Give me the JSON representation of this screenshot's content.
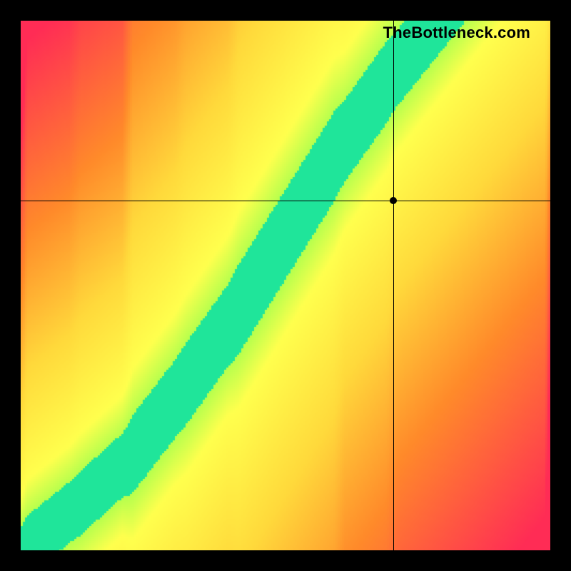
{
  "watermark": "TheBottleneck.com",
  "chart_data": {
    "type": "heatmap",
    "title": "",
    "xlabel": "",
    "ylabel": "",
    "xlim": [
      0,
      1
    ],
    "ylim": [
      0,
      1
    ],
    "crosshair": {
      "x": 0.705,
      "y": 0.66
    },
    "marker": {
      "x": 0.705,
      "y": 0.66
    },
    "optimal_band": {
      "description": "Green diagonal band of optimal balance; outside band transitions through yellow to orange to red.",
      "center_points": [
        {
          "x": 0.0,
          "y": 0.0
        },
        {
          "x": 0.1,
          "y": 0.08
        },
        {
          "x": 0.2,
          "y": 0.17
        },
        {
          "x": 0.3,
          "y": 0.3
        },
        {
          "x": 0.4,
          "y": 0.44
        },
        {
          "x": 0.5,
          "y": 0.6
        },
        {
          "x": 0.6,
          "y": 0.76
        },
        {
          "x": 0.7,
          "y": 0.9
        },
        {
          "x": 0.78,
          "y": 1.0
        }
      ],
      "band_half_width": 0.045
    },
    "color_scale": [
      {
        "value": 0.0,
        "color": "#ff2c55"
      },
      {
        "value": 0.35,
        "color": "#ff8a2a"
      },
      {
        "value": 0.6,
        "color": "#ffd93b"
      },
      {
        "value": 0.8,
        "color": "#ffff4d"
      },
      {
        "value": 0.92,
        "color": "#b6ff4d"
      },
      {
        "value": 1.0,
        "color": "#1fe59a"
      }
    ],
    "grid": false,
    "legend": false
  }
}
